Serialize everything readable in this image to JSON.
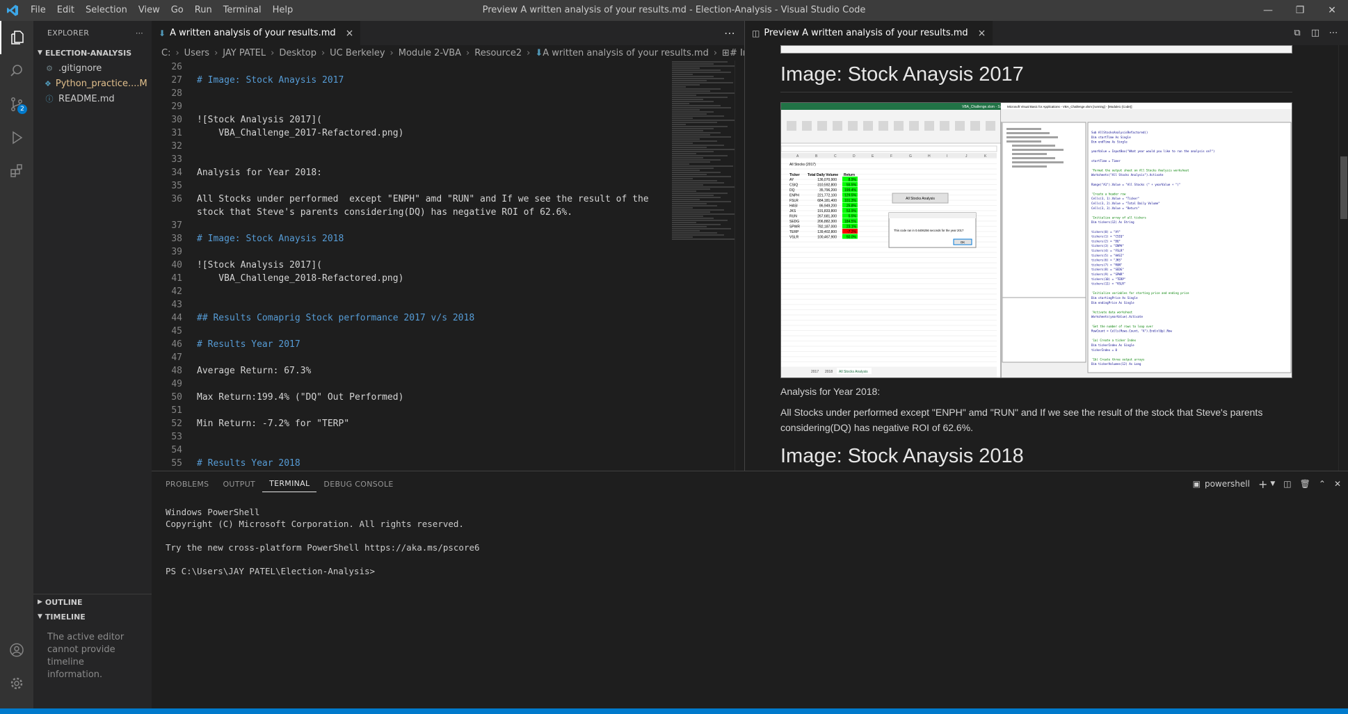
{
  "window": {
    "title": "Preview A written analysis of your results.md - Election-Analysis - Visual Studio Code",
    "menu": [
      "File",
      "Edit",
      "Selection",
      "View",
      "Go",
      "Run",
      "Terminal",
      "Help"
    ]
  },
  "activity": {
    "scm_badge": "2"
  },
  "explorer": {
    "header": "EXPLORER",
    "folder": "ELECTION-ANALYSIS",
    "files": [
      {
        "name": ".gitignore",
        "icon": "gear-icon",
        "status": ""
      },
      {
        "name": "Python_practice....",
        "icon": "python-icon",
        "status": "M"
      },
      {
        "name": "README.md",
        "icon": "info-icon",
        "status": ""
      }
    ],
    "outline": "OUTLINE",
    "timeline": "TIMELINE",
    "timeline_msg": "The active editor cannot provide timeline information."
  },
  "editor": {
    "tab": "A written analysis of your results.md",
    "breadcrumbs": [
      "C:",
      "Users",
      "JAY PATEL",
      "Desktop",
      "UC Berkeley",
      "Module 2-VBA",
      "Resource2",
      "A written analysis of your results.md",
      "# Image DQ Analy"
    ],
    "lines": [
      {
        "n": "26",
        "t": "",
        "h": false
      },
      {
        "n": "27",
        "t": "# Image: Stock Anaysis 2017",
        "h": true
      },
      {
        "n": "28",
        "t": "",
        "h": false
      },
      {
        "n": "29",
        "t": "",
        "h": false
      },
      {
        "n": "30",
        "t": "![Stock Analysis 2017](",
        "h": false
      },
      {
        "n": "31",
        "t": "    VBA_Challenge_2017-Refactored.png)",
        "h": false
      },
      {
        "n": "32",
        "t": "",
        "h": false
      },
      {
        "n": "33",
        "t": "",
        "h": false
      },
      {
        "n": "34",
        "t": "Analysis for Year 2018:",
        "h": false
      },
      {
        "n": "35",
        "t": "",
        "h": false
      },
      {
        "n": "36",
        "t": "All Stocks under performed  except \"ENPH\" amd \"RUN\" and If we see the result of the",
        "h": false
      },
      {
        "n": "",
        "t": "stock that Steve's parents considering(DQ) has negative ROI of 62.6%.",
        "h": false
      },
      {
        "n": "37",
        "t": "",
        "h": false
      },
      {
        "n": "38",
        "t": "# Image: Stock Anaysis 2018",
        "h": true
      },
      {
        "n": "39",
        "t": "",
        "h": false
      },
      {
        "n": "40",
        "t": "![Stock Analysis 2017](",
        "h": false
      },
      {
        "n": "41",
        "t": "    VBA_Challenge_2018-Refactored.png)",
        "h": false
      },
      {
        "n": "42",
        "t": "",
        "h": false
      },
      {
        "n": "43",
        "t": "",
        "h": false
      },
      {
        "n": "44",
        "t": "## Results Comaprig Stock performance 2017 v/s 2018",
        "h": true
      },
      {
        "n": "45",
        "t": "",
        "h": false
      },
      {
        "n": "46",
        "t": "# Results Year 2017",
        "h": true
      },
      {
        "n": "47",
        "t": "",
        "h": false
      },
      {
        "n": "48",
        "t": "Average Return: 67.3%",
        "h": false
      },
      {
        "n": "49",
        "t": "",
        "h": false
      },
      {
        "n": "50",
        "t": "Max Return:199.4% (\"DQ\" Out Performed)",
        "h": false
      },
      {
        "n": "51",
        "t": "",
        "h": false
      },
      {
        "n": "52",
        "t": "Min Return: -7.2% for \"TERP\"",
        "h": false
      },
      {
        "n": "53",
        "t": "",
        "h": false
      },
      {
        "n": "54",
        "t": "",
        "h": false
      },
      {
        "n": "55",
        "t": "# Results Year 2018",
        "h": true
      }
    ]
  },
  "preview": {
    "tab": "Preview A written analysis of your results.md",
    "h1_2017": "Image: Stock Anaysis 2017",
    "p1": "Analysis for Year 2018:",
    "p2": "All Stocks under performed except \"ENPH\" amd \"RUN\" and If we see the result of the stock that Steve's parents considering(DQ) has negative ROI of 62.6%.",
    "h1_2018": "Image: Stock Anaysis 2018",
    "shot": {
      "excel_title": "VBA_Challenge.xlsm - Saved",
      "vba_title": "Microsoft Visual Basic for Applications - VBA_Challenge.xlsm [running] - [Module1 (Code)]",
      "sheet_title": "All Stocks (2017)",
      "headers": [
        "Ticker",
        "Total Daily Volume",
        "Return"
      ],
      "rows": [
        {
          "t": "AY",
          "v": "136,070,900",
          "r": "8.9%",
          "c": "#00ff00"
        },
        {
          "t": "CSIQ",
          "v": "310,592,800",
          "r": "55.5%",
          "c": "#00ff00"
        },
        {
          "t": "DQ",
          "v": "35,796,200",
          "r": "199.4%",
          "c": "#00ff00"
        },
        {
          "t": "ENPH",
          "v": "221,772,100",
          "r": "129.5%",
          "c": "#00ff00"
        },
        {
          "t": "FSLR",
          "v": "684,181,400",
          "r": "101.3%",
          "c": "#00ff00"
        },
        {
          "t": "HASI",
          "v": "86,949,200",
          "r": "25.8%",
          "c": "#00ff00"
        },
        {
          "t": "JKS",
          "v": "191,833,800",
          "r": "53.9%",
          "c": "#00ff00"
        },
        {
          "t": "RUN",
          "v": "267,681,300",
          "r": "5.5%",
          "c": "#00ff00"
        },
        {
          "t": "SEDG",
          "v": "206,882,300",
          "r": "184.5%",
          "c": "#00ff00"
        },
        {
          "t": "SPWR",
          "v": "782,187,000",
          "r": "23.1%",
          "c": "#00ff00"
        },
        {
          "t": "TERP",
          "v": "139,402,800",
          "r": "-7.2%",
          "c": "#ff0000"
        },
        {
          "t": "VSLR",
          "v": "100,467,900",
          "r": "50.0%",
          "c": "#00ff00"
        }
      ],
      "button_label": "All Stocks Analysis",
      "msgbox_text": "This code ran in 0.6406256 seconds for the year 2017",
      "msgbox_ok": "OK",
      "sheet_tabs": [
        "2017",
        "2018",
        "All Stocks Analysis"
      ],
      "code": [
        "Sub AllStocksAnalysisRefactored()",
        "    Dim startTime As Single",
        "    Dim endTime  As Single",
        "",
        "    yearValue = InputBox(\"What year would you like to run the analysis on?\")",
        "",
        "    startTime = Timer",
        "",
        "    'Format the output sheet on All Stocks Analysis worksheet",
        "    Worksheets(\"All Stocks Analysis\").Activate",
        "",
        "    Range(\"A1\").Value = \"All Stocks (\" + yearValue + \")\"",
        "",
        "    'Create a header row",
        "    Cells(3, 1).Value = \"Ticker\"",
        "    Cells(3, 2).Value = \"Total Daily Volume\"",
        "    Cells(3, 3).Value = \"Return\"",
        "",
        "    'Initialize array of all tickers",
        "    Dim tickers(12) As String",
        "",
        "    tickers(0) = \"AY\"",
        "    tickers(1) = \"CSIQ\"",
        "    tickers(2) = \"DQ\"",
        "    tickers(3) = \"ENPH\"",
        "    tickers(4) = \"FSLR\"",
        "    tickers(5) = \"HASI\"",
        "    tickers(6) = \"JKS\"",
        "    tickers(7) = \"RUN\"",
        "    tickers(8) = \"SEDG\"",
        "    tickers(9) = \"SPWR\"",
        "    tickers(10) = \"TERP\"",
        "    tickers(11) = \"VSLR\"",
        "",
        "    'Initialize variables for starting price and ending price",
        "    Dim startingPrice As Single",
        "    Dim endingPrice As Single",
        "",
        "    'Activate data worksheet",
        "    Worksheets(yearValue).Activate",
        "",
        "    'Get the number of rows to loop over",
        "    RowCount = Cells(Rows.Count, \"A\").End(xlUp).Row",
        "",
        "    '1a) Create a ticker Index",
        "    Dim tickerIndex As Single",
        "    tickerIndex = 0",
        "",
        "    '1b) Create three output arrays",
        "    Dim tickerVolumes(12) As Long"
      ]
    }
  },
  "panel": {
    "tabs": [
      "PROBLEMS",
      "OUTPUT",
      "TERMINAL",
      "DEBUG CONSOLE"
    ],
    "shell": "powershell",
    "terminal": [
      "Windows PowerShell",
      "Copyright (C) Microsoft Corporation. All rights reserved.",
      "",
      "Try the new cross-platform PowerShell https://aka.ms/pscore6",
      "",
      "PS C:\\Users\\JAY PATEL\\Election-Analysis>"
    ]
  },
  "colors": {
    "accent": "#007acc",
    "heading": "#569cd6",
    "modified": "#e2c08d"
  }
}
